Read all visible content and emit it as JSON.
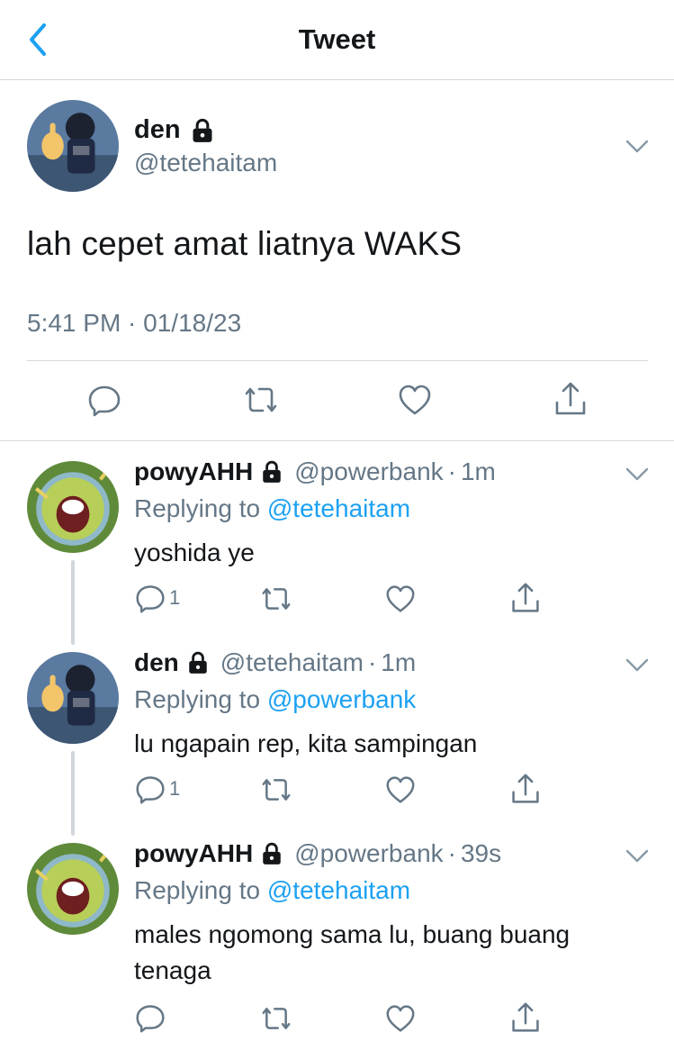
{
  "header": {
    "title": "Tweet",
    "back_icon": "chevron-left-icon"
  },
  "main_tweet": {
    "name": "den",
    "handle": "@tetehaitam",
    "text": "lah cepet amat liatnya WAKS",
    "timestamp": "5:41 PM · 01/18/23",
    "actions": [
      "reply-icon",
      "retweet-icon",
      "like-icon",
      "share-icon"
    ]
  },
  "replies": [
    {
      "name": "powyAHH",
      "handle": "@powerbank",
      "dot": "·",
      "time": "1m",
      "replying_prefix": "Replying to",
      "replying_to": "@tetehaitam",
      "text": "yoshida ye",
      "reply_count": "1"
    },
    {
      "name": "den",
      "handle": "@tetehaitam",
      "dot": "·",
      "time": "1m",
      "replying_prefix": "Replying to",
      "replying_to": "@powerbank",
      "text": "lu ngapain rep, kita sampingan",
      "reply_count": "1"
    },
    {
      "name": "powyAHH",
      "handle": "@powerbank",
      "dot": "·",
      "time": "39s",
      "replying_prefix": "Replying to",
      "replying_to": "@tetehaitam",
      "text": "males ngomong sama lu, buang buang tenaga",
      "reply_count": ""
    }
  ],
  "colors": {
    "accent": "#1da1f2",
    "muted": "#657786",
    "divider": "#d6d9dc",
    "text": "#14171a"
  }
}
